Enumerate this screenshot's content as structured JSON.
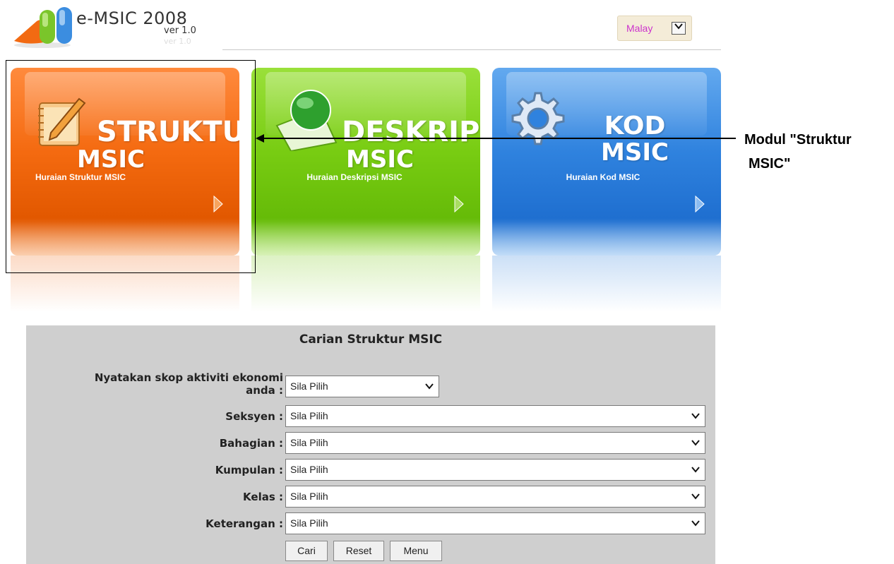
{
  "header": {
    "app_name": "e-MSIC 2008",
    "version": "ver 1.0",
    "version_ghost": "ver 1.0",
    "language": {
      "selected": "Malay",
      "icon": "chevron-down-icon"
    }
  },
  "tiles": [
    {
      "title_line1": "STRUKTUR",
      "title_line2": "MSIC",
      "subtitle": "Huraian Struktur MSIC",
      "color": "#f46a10",
      "icon": "notebook-pencil-icon"
    },
    {
      "title_line1": "DESKRIPSI",
      "title_line2": "MSIC",
      "subtitle": "Huraian Deskripsi MSIC",
      "color": "#78cc12",
      "icon": "globe-icon"
    },
    {
      "title_line1": "KOD",
      "title_line2": "MSIC",
      "subtitle": "Huraian Kod MSIC",
      "color": "#2f82de",
      "icon": "gear-icon"
    }
  ],
  "annotation": {
    "line1": "Modul \"Struktur",
    "line2": "MSIC\""
  },
  "form": {
    "title": "Carian Struktur MSIC",
    "fields": [
      {
        "label_line1": "Nyatakan skop aktiviti ekonomi",
        "label_line2": "anda :",
        "value": "Sila Pilih"
      },
      {
        "label": "Seksyen :",
        "value": "Sila Pilih"
      },
      {
        "label": "Bahagian :",
        "value": "Sila Pilih"
      },
      {
        "label": "Kumpulan :",
        "value": "Sila Pilih"
      },
      {
        "label": "Kelas :",
        "value": "Sila Pilih"
      },
      {
        "label": "Keterangan :",
        "value": "Sila Pilih"
      }
    ],
    "buttons": {
      "search": "Cari",
      "reset": "Reset",
      "menu": "Menu"
    }
  }
}
